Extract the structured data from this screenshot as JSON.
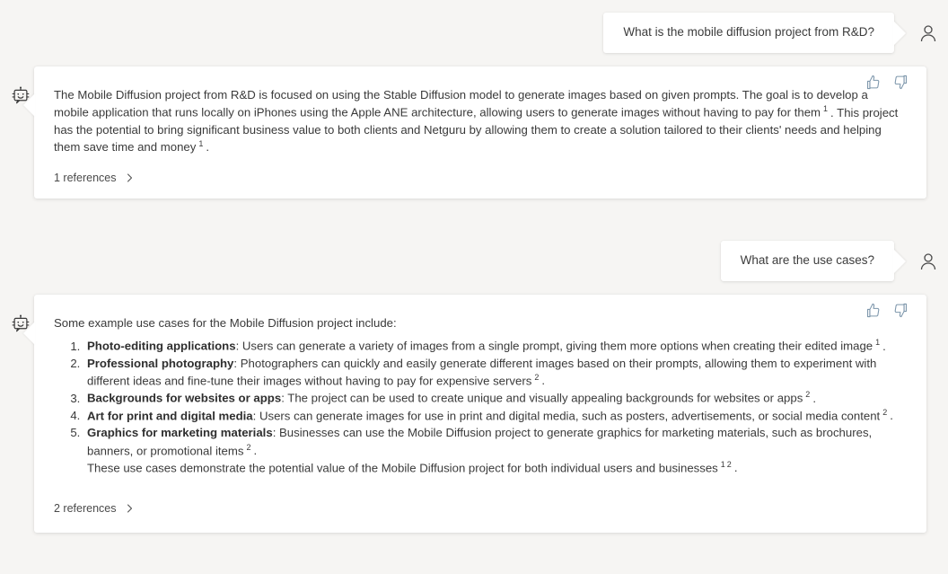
{
  "theme": {
    "page_background": "#f6f5f3",
    "card_background": "#ffffff",
    "text_color": "#3a3a3a",
    "feedback_icon_color": "#7d96ab"
  },
  "conversation": [
    {
      "role": "user",
      "avatar_icon": "person-icon",
      "text": "What is the mobile diffusion project from R&D?"
    },
    {
      "role": "assistant",
      "avatar_icon": "bot-icon",
      "thumbs_up_icon": "thumbs-up-icon",
      "thumbs_down_icon": "thumbs-down-icon",
      "paragraph_part_1": "The Mobile Diffusion project from R&D is focused on using the Stable Diffusion model to generate images based on given prompts. The goal is to develop a mobile application that runs locally on iPhones using the Apple ANE architecture, allowing users to generate images without having to pay for them",
      "citation_1": "1",
      "paragraph_part_2": ". This project has the potential to bring significant business value to both clients and Netguru by allowing them to create a solution tailored to their clients' needs and helping them save time and money",
      "citation_2": "1",
      "paragraph_part_3": ".",
      "references_label": "1 references",
      "references_chevron_icon": "chevron-right-icon"
    },
    {
      "role": "user",
      "avatar_icon": "person-icon",
      "text": "What are the use cases?"
    },
    {
      "role": "assistant",
      "avatar_icon": "bot-icon",
      "thumbs_up_icon": "thumbs-up-icon",
      "thumbs_down_icon": "thumbs-down-icon",
      "intro": "Some example use cases for the Mobile Diffusion project include:",
      "items": [
        {
          "term": "Photo-editing applications",
          "body": ": Users can generate a variety of images from a single prompt, giving them more options when creating their edited image",
          "citation": "1",
          "tail": "."
        },
        {
          "term": "Professional photography",
          "body": ": Photographers can quickly and easily generate different images based on their prompts, allowing them to experiment with different ideas and fine-tune their images without having to pay for expensive servers",
          "citation": "2",
          "tail": "."
        },
        {
          "term": "Backgrounds for websites or apps",
          "body": ": The project can be used to create unique and visually appealing backgrounds for websites or apps",
          "citation": "2",
          "tail": "."
        },
        {
          "term": "Art for print and digital media",
          "body": ": Users can generate images for use in print and digital media, such as posters, advertisements, or social media content",
          "citation": "2",
          "tail": "."
        },
        {
          "term": "Graphics for marketing materials",
          "body": ": Businesses can use the Mobile Diffusion project to generate graphics for marketing materials, such as brochures, banners, or promotional items",
          "citation": "2",
          "tail": "."
        }
      ],
      "closing": "These use cases demonstrate the potential value of the Mobile Diffusion project for both individual users and businesses",
      "closing_citation_1": "1",
      "closing_citation_2": "2",
      "closing_tail": ".",
      "references_label": "2 references",
      "references_chevron_icon": "chevron-right-icon"
    }
  ]
}
